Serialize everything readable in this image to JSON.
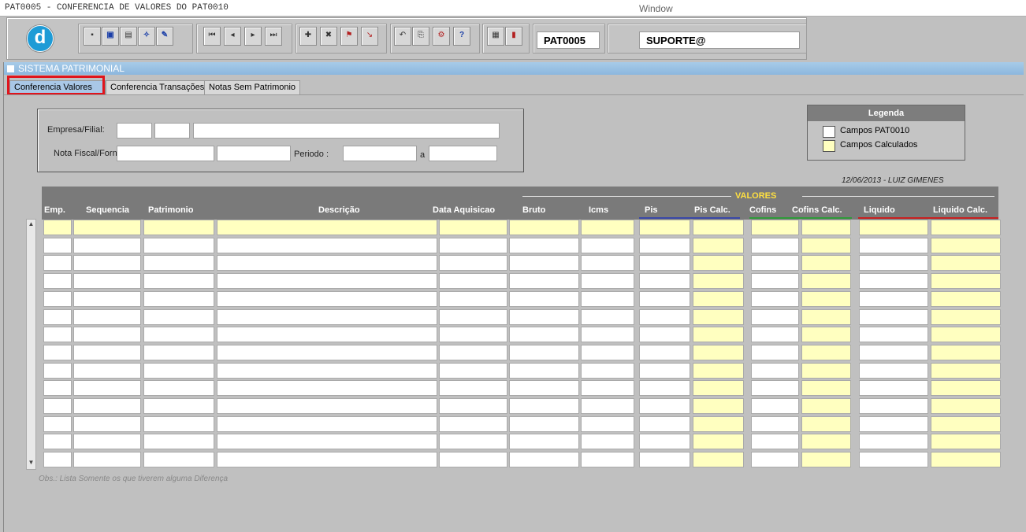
{
  "window": {
    "title": "PAT0005 - CONFERENCIA DE VALORES DO PAT0010",
    "label": "Window"
  },
  "toolbar": {
    "logo_letter": "d",
    "program_code": "PAT0005",
    "user": "SUPORTE@",
    "buttons": [
      "save-icon",
      "window-icon",
      "print-icon",
      "magic-wand-icon",
      "edit-icon",
      "first-record-icon",
      "previous-record-icon",
      "next-record-icon",
      "last-record-icon",
      "insert-record-icon",
      "delete-record-icon",
      "query-icon",
      "clear-icon",
      "undo-icon",
      "copy-icon",
      "tools-icon",
      "help-icon",
      "calculator-icon",
      "exit-icon"
    ]
  },
  "mdi": {
    "title": "SISTEMA PATRIMONIAL"
  },
  "tabs": [
    {
      "label": "Conferencia Valores",
      "active": true
    },
    {
      "label": "Conferencia Transações",
      "active": false
    },
    {
      "label": "Notas Sem Patrimonio",
      "active": false
    }
  ],
  "filters": {
    "empresa_label": "Empresa/Filial:",
    "nota_label": "Nota Fiscal/Forn",
    "periodo_label": "Periodo :",
    "a_label": "a"
  },
  "legend": {
    "title": "Legenda",
    "items": [
      {
        "label": "Campos PAT0010",
        "color": "#ffffff"
      },
      {
        "label": "Campos Calculados",
        "color": "#ffffc0"
      }
    ]
  },
  "date_user": "12/06/2013 - LUIZ GIMENES",
  "grid": {
    "group_label": "VALORES",
    "columns": [
      "Emp.",
      "Sequencia",
      "Patrimonio",
      "Descrição",
      "Data Aquisicao",
      "Bruto",
      "Icms",
      "Pis",
      "Pis Calc.",
      "Cofins",
      "Cofins Calc.",
      "Liquido",
      "Liquido Calc."
    ],
    "row_count": 14
  },
  "obs": "Obs.: Lista Somente os que tiverem alguma Diferença"
}
